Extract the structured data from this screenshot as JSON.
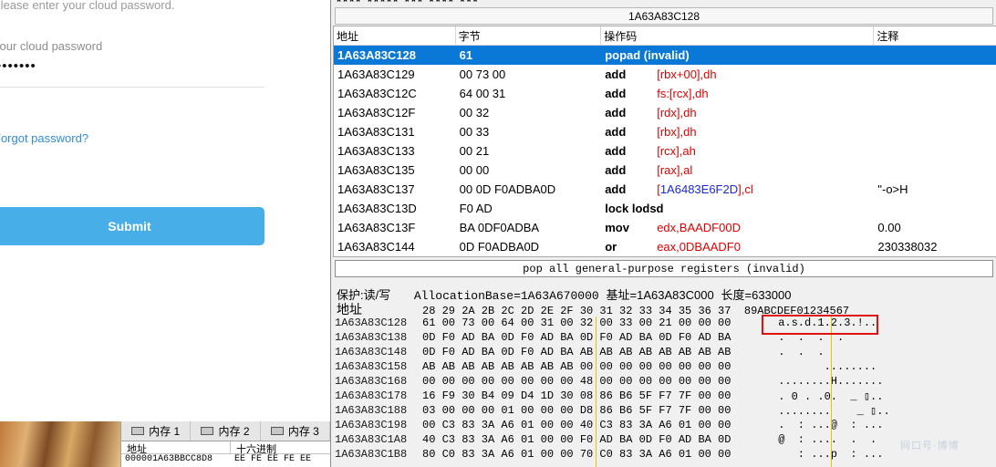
{
  "login": {
    "hint": "Please enter your cloud password.",
    "field_label": "Your cloud password",
    "password_masked": "•••••••",
    "forgot": "Forgot password?",
    "submit": "Submit"
  },
  "dump_panel2": {
    "tabs": [
      "内存 1",
      "内存 2",
      "内存 3"
    ],
    "headers": [
      "地址",
      "十六进制"
    ],
    "row": {
      "address": "000001A63BBCC8D8",
      "hex": "EE FE EE FE EE"
    }
  },
  "debugger": {
    "top_cut_text": "**** ***** *** **** ***",
    "address_title": "1A63A83C128",
    "disasm_columns": [
      "地址",
      "字节",
      "操作码",
      "注释"
    ],
    "disasm_rows": [
      {
        "addr": "1A63A83C128",
        "bytes": "61",
        "mnemonic": "popad (invalid)",
        "operand": "",
        "comment": ""
      },
      {
        "addr": "1A63A83C129",
        "bytes": "00 73 00",
        "mnemonic": "add",
        "operand": "[rbx+00],dh",
        "comment": ""
      },
      {
        "addr": "1A63A83C12C",
        "bytes": "64 00 31",
        "mnemonic": "add",
        "operand": "fs:[rcx],dh",
        "comment": ""
      },
      {
        "addr": "1A63A83C12F",
        "bytes": "00 32",
        "mnemonic": "add",
        "operand": "[rdx],dh",
        "comment": ""
      },
      {
        "addr": "1A63A83C131",
        "bytes": "00 33",
        "mnemonic": "add",
        "operand": "[rbx],dh",
        "comment": ""
      },
      {
        "addr": "1A63A83C133",
        "bytes": "00 21",
        "mnemonic": "add",
        "operand": "[rcx],ah",
        "comment": ""
      },
      {
        "addr": "1A63A83C135",
        "bytes": "00 00",
        "mnemonic": "add",
        "operand": "[rax],al",
        "comment": ""
      },
      {
        "addr": "1A63A83C137",
        "bytes": "00 0D F0ADBA0D",
        "mnemonic": "add",
        "operand": "[1A6483E6F2D],cl",
        "comment": "\"-o>H"
      },
      {
        "addr": "1A63A83C13D",
        "bytes": "F0 AD",
        "mnemonic": "lock lodsd",
        "operand": "",
        "comment": ""
      },
      {
        "addr": "1A63A83C13F",
        "bytes": "BA 0DF0ADBA",
        "mnemonic": "mov",
        "operand": "edx,BAADF00D",
        "comment": "0.00"
      },
      {
        "addr": "1A63A83C144",
        "bytes": "0D F0ADBA0D",
        "mnemonic": "or",
        "operand": "eax,0DBAADF0",
        "comment": "230338032"
      }
    ],
    "info_line": "pop all general-purpose registers (invalid)",
    "dump_meta": {
      "protect_label": "保护:读/写",
      "alloc": "AllocationBase=1A63A670000",
      "base_label": "基址=1A63A83C000",
      "length_label": "长度=633000"
    },
    "dump_header": {
      "addr_label": "地址",
      "hex_cols": "28 29 2A 2B 2C 2D 2E 2F 30 31 32 33 34 35 36 37",
      "ascii_cols": "89ABCDEF01234567"
    },
    "dump_rows": [
      {
        "addr": "1A63A83C128",
        "hex": "61 00 73 00 64 00 31 00 32 00 33 00 21 00 00 00",
        "ascii": " a.s.d.1.2.3.!.."
      },
      {
        "addr": "1A63A83C138",
        "hex": "0D F0 AD BA 0D F0 AD BA 0D F0 AD BA 0D F0 AD BA",
        "ascii": " .  .  .  .  "
      },
      {
        "addr": "1A63A83C148",
        "hex": "0D F0 AD BA 0D F0 AD BA AB AB AB AB AB AB AB AB",
        "ascii": " .  .  ."
      },
      {
        "addr": "1A63A83C158",
        "hex": "AB AB AB AB AB AB AB AB 00 00 00 00 00 00 00 00",
        "ascii": "        ........"
      },
      {
        "addr": "1A63A83C168",
        "hex": "00 00 00 00 00 00 00 00 48 00 00 00 00 00 00 00",
        "ascii": " ........H......."
      },
      {
        "addr": "1A63A83C178",
        "hex": "16 F9 30 B4 09 D4 1D 30 08 86 B6 5F F7 7F 00 00",
        "ascii": " . 0 . .0.  _ ▯.."
      },
      {
        "addr": "1A63A83C188",
        "hex": "03 00 00 00 01 00 00 00 D8 86 B6 5F F7 7F 00 00",
        "ascii": " ........    _ ▯.."
      },
      {
        "addr": "1A63A83C198",
        "hex": "00 C3 83 3A A6 01 00 00 40 C3 83 3A A6 01 00 00",
        "ascii": " .  : ...@  : ..."
      },
      {
        "addr": "1A63A83C1A8",
        "hex": "40 C3 83 3A A6 01 00 00 F0 AD BA 0D F0 AD BA 0D",
        "ascii": " @  : ....  .  ."
      },
      {
        "addr": "1A63A83C1B8",
        "hex": "80 C0 83 3A A6 01 00 00 70 C0 83 3A A6 01 00 00",
        "ascii": "    : ...p  : ..."
      }
    ],
    "watermark": "网口号·博博"
  }
}
